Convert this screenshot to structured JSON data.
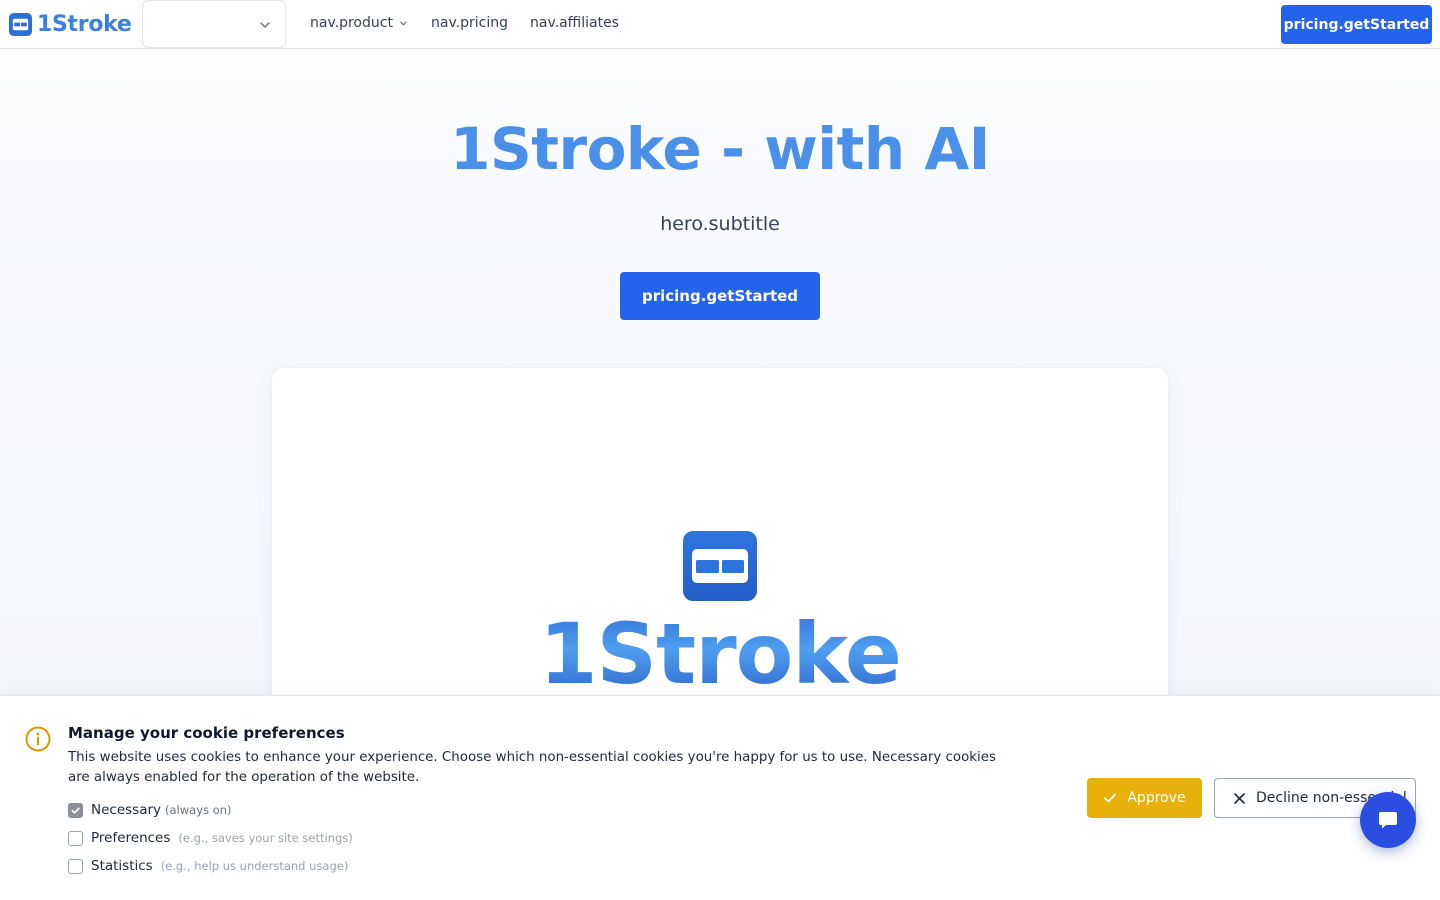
{
  "brand": {
    "name": "1Stroke",
    "color": "#3b7fe0"
  },
  "header": {
    "language_select": {
      "value": ""
    },
    "nav": [
      {
        "label": "nav.product",
        "has_dropdown": true
      },
      {
        "label": "nav.pricing",
        "has_dropdown": false
      },
      {
        "label": "nav.affiliates",
        "has_dropdown": false
      }
    ],
    "cta_label": "pricing.getStarted"
  },
  "hero": {
    "title": "1Stroke - with AI",
    "subtitle": "hero.subtitle",
    "cta_label": "pricing.getStarted"
  },
  "preview": {
    "logo_text": "1Stroke",
    "icon": "1stroke-logo-icon"
  },
  "cookie_banner": {
    "icon": "info-icon",
    "title": "Manage your cookie preferences",
    "text": "This website uses cookies to enhance your experience. Choose which non-essential cookies you're happy for us to use. Necessary cookies are always enabled for the operation of the website.",
    "options": [
      {
        "label": "Necessary",
        "hint": "(always on)",
        "checked": true,
        "disabled": true
      },
      {
        "label": "Preferences",
        "hint": "(e.g., saves your site settings)",
        "checked": false,
        "disabled": false
      },
      {
        "label": "Statistics",
        "hint": "(e.g., help us understand usage)",
        "checked": false,
        "disabled": false
      }
    ],
    "approve_label": "Approve",
    "decline_label": "Decline non-essential"
  },
  "chat": {
    "icon": "chat-bubble-icon"
  },
  "colors": {
    "primary": "#2563eb",
    "hero_title": "#4a90e8",
    "approve": "#e8b00b",
    "info_icon": "#d99a00",
    "chat_fab": "#2b4ee0"
  }
}
